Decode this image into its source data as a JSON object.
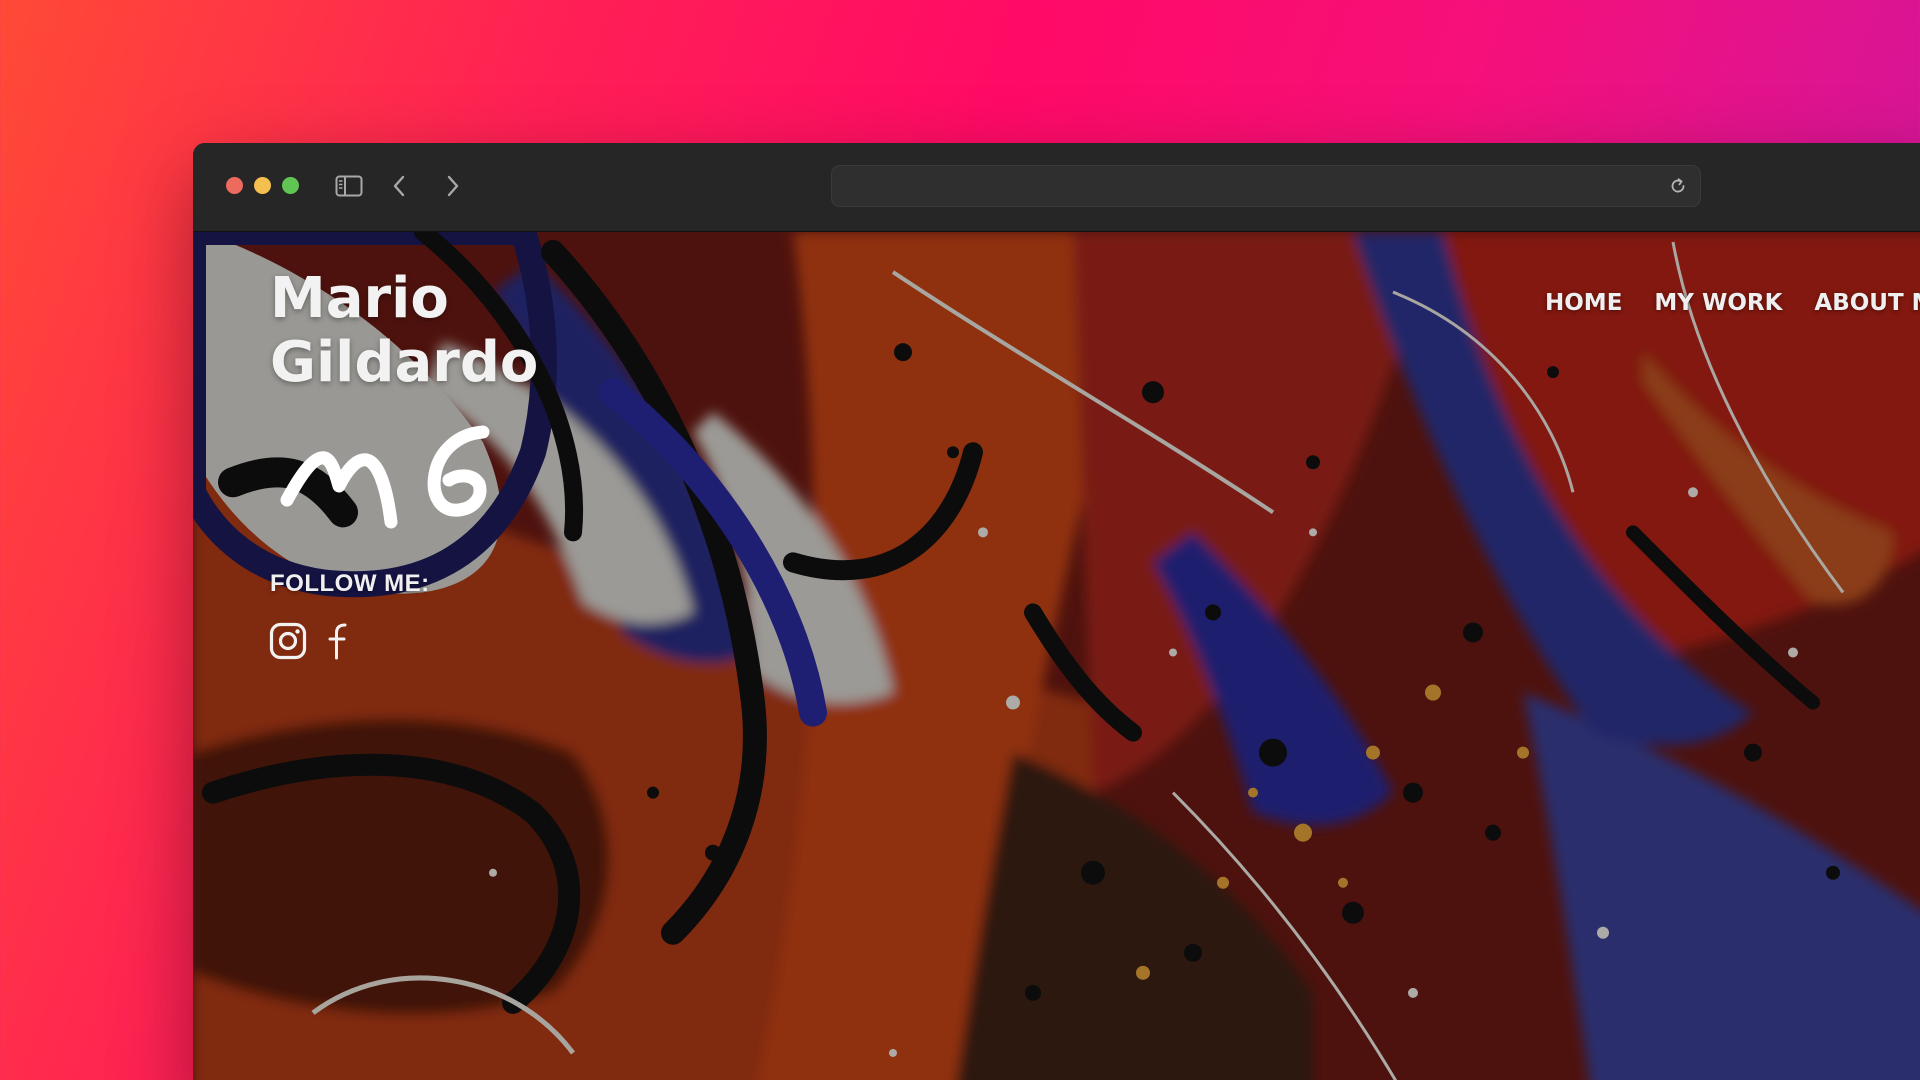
{
  "browser": {
    "address_bar_text": "",
    "icons": {
      "sidebar": "sidebar-toggle-icon",
      "back": "chevron-left-icon",
      "forward": "chevron-right-icon",
      "reload": "reload-icon"
    },
    "traffic_lights": {
      "close": "#ed6a5e",
      "minimize": "#f5bf4f",
      "zoom": "#61c554"
    }
  },
  "site": {
    "title_line1": "Mario",
    "title_line2": "Gildardo",
    "logo_text": "MG",
    "follow_label": "FOLLOW ME:",
    "social": [
      {
        "name": "instagram",
        "icon": "instagram-icon"
      },
      {
        "name": "facebook",
        "icon": "facebook-icon"
      }
    ],
    "nav": [
      {
        "label": "HOME"
      },
      {
        "label": "MY WORK"
      },
      {
        "label": "ABOUT ME"
      }
    ]
  },
  "colors": {
    "background_gradient": [
      "#ff4a36",
      "#ff0a66",
      "#c21aa3"
    ],
    "toolbar": "#262626",
    "text_light": "#f2f2f2"
  }
}
